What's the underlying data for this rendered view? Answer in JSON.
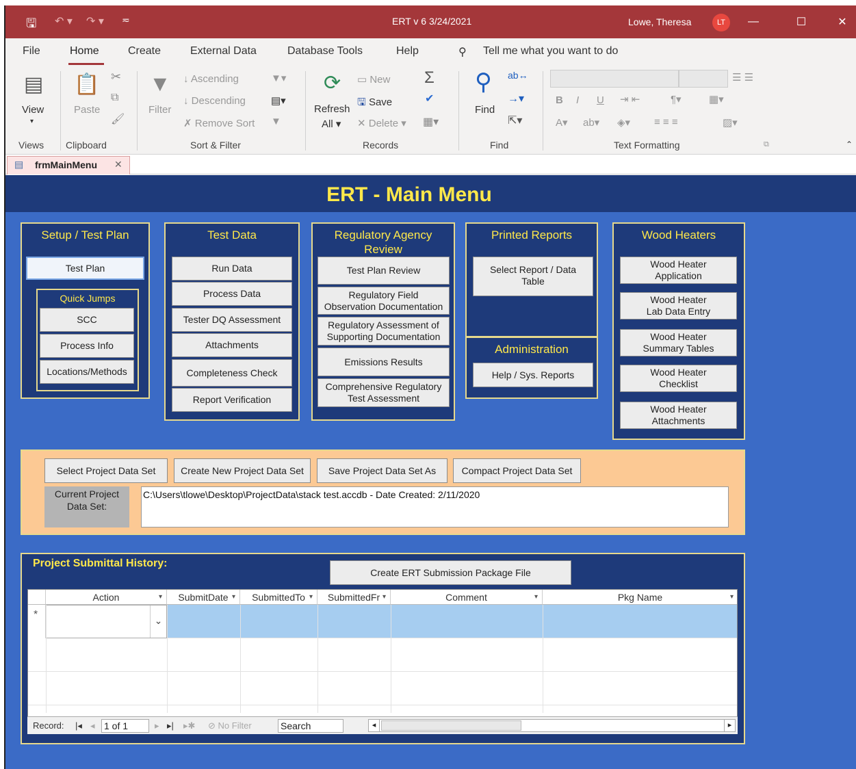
{
  "titlebar": {
    "app_title": "ERT v 6  3/24/2021",
    "user_name": "Lowe, Theresa",
    "user_initials": "LT"
  },
  "ribbon": {
    "menu": [
      "File",
      "Home",
      "Create",
      "External Data",
      "Database Tools",
      "Help"
    ],
    "tell_me": "Tell me what you want to do",
    "views": {
      "view_label": "View",
      "group": "Views"
    },
    "clipboard": {
      "paste": "Paste",
      "group": "Clipboard"
    },
    "sort_filter": {
      "filter": "Filter",
      "ascending": "Ascending",
      "descending": "Descending",
      "remove_sort": "Remove Sort",
      "group": "Sort & Filter"
    },
    "records": {
      "refresh": "Refresh",
      "all": "All",
      "new": "New",
      "save": "Save",
      "delete": "Delete",
      "group": "Records"
    },
    "find": {
      "find": "Find",
      "group": "Find"
    },
    "text_formatting": {
      "group": "Text Formatting"
    }
  },
  "doc_tab": {
    "label": "frmMainMenu"
  },
  "form": {
    "title": "ERT - Main Menu",
    "setup": {
      "title": "Setup / Test Plan",
      "test_plan": "Test Plan",
      "quick_jumps": "Quick Jumps",
      "scc": "SCC",
      "process_info": "Process Info",
      "locations": "Locations/Methods"
    },
    "test_data": {
      "title": "Test Data",
      "buttons": [
        "Run Data",
        "Process Data",
        "Tester DQ Assessment",
        "Attachments",
        "Completeness Check",
        "Report Verification"
      ]
    },
    "regulatory": {
      "title_line1": "Regulatory Agency",
      "title_line2": "Review",
      "buttons": [
        [
          "Test Plan Review"
        ],
        [
          "Regulatory Field",
          "Observation Documentation"
        ],
        [
          "Regulatory Assessment of",
          "Supporting Documentation"
        ],
        [
          "Emissions Results"
        ],
        [
          "Comprehensive Regulatory",
          "Test Assessment"
        ]
      ]
    },
    "printed": {
      "title": "Printed Reports",
      "select_line1": "Select Report / Data",
      "select_line2": "Table"
    },
    "admin": {
      "title": "Administration",
      "help": "Help / Sys. Reports"
    },
    "wood": {
      "title": "Wood Heaters",
      "buttons": [
        [
          "Wood Heater",
          "Application"
        ],
        [
          "Wood Heater",
          "Lab Data Entry"
        ],
        [
          "Wood Heater",
          "Summary Tables"
        ],
        [
          "Wood Heater",
          "Checklist"
        ],
        [
          "Wood Heater",
          "Attachments"
        ]
      ]
    },
    "project": {
      "select": "Select Project Data Set",
      "create_new": "Create New Project Data Set",
      "save_as": "Save Project Data Set As",
      "compact": "Compact Project Data Set",
      "current_label_line1": "Current Project",
      "current_label_line2": "Data Set:",
      "current_value": "C:\\Users\\tlowe\\Desktop\\ProjectData\\stack test.accdb - Date Created: 2/11/2020"
    },
    "submittal": {
      "title": "Project Submittal History:",
      "create_package": "Create ERT Submission Package File",
      "columns": [
        "Action",
        "SubmitDate",
        "SubmittedTo",
        "SubmittedFr",
        "Comment",
        "Pkg Name"
      ],
      "new_row_marker": "*",
      "nav": {
        "record_label": "Record:",
        "position": "1 of 1",
        "no_filter": "No Filter",
        "search": "Search"
      }
    }
  },
  "colors": {
    "titlebar": "#a4373a",
    "form_bg": "#3b6bc6",
    "panel_bg": "#1e3a7a",
    "title_yellow": "#ffe84a",
    "project_panel": "#fcc994"
  }
}
